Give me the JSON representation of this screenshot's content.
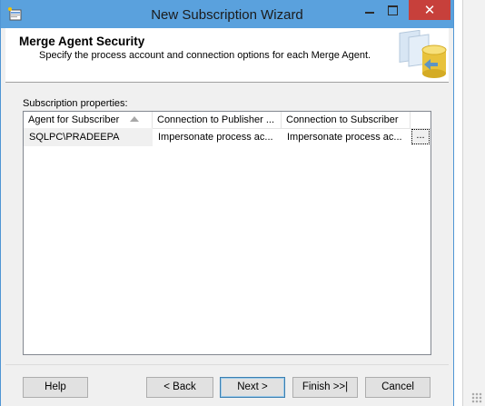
{
  "window": {
    "title": "New Subscription Wizard",
    "close_glyph": "✕",
    "icons": {
      "app": "wizard-app-icon",
      "minimize": "minimize-icon",
      "maximize": "maximize-icon",
      "close": "close-icon"
    }
  },
  "header": {
    "title": "Merge Agent Security",
    "subtitle": "Specify the process account and connection options for each Merge Agent.",
    "graphic": "database-icon"
  },
  "content": {
    "properties_label": "Subscription properties:",
    "grid": {
      "columns": [
        "Agent for Subscriber",
        "Connection to Publisher ...",
        "Connection to Subscriber"
      ],
      "sort_icon": "sort-ascending-icon",
      "rows": [
        {
          "agent": "SQLPC\\PRADEEPA",
          "publisher_conn": "Impersonate process ac...",
          "subscriber_conn": "Impersonate process ac..."
        }
      ],
      "row_button_label": "..."
    }
  },
  "footer": {
    "help": "Help",
    "back": "< Back",
    "next": "Next >",
    "finish": "Finish >>|",
    "cancel": "Cancel"
  },
  "colors": {
    "titlebar": "#5aa1dd",
    "close_button": "#c7403b",
    "dialog_background": "#f0f0f0",
    "default_button_border": "#3c7fb1"
  }
}
